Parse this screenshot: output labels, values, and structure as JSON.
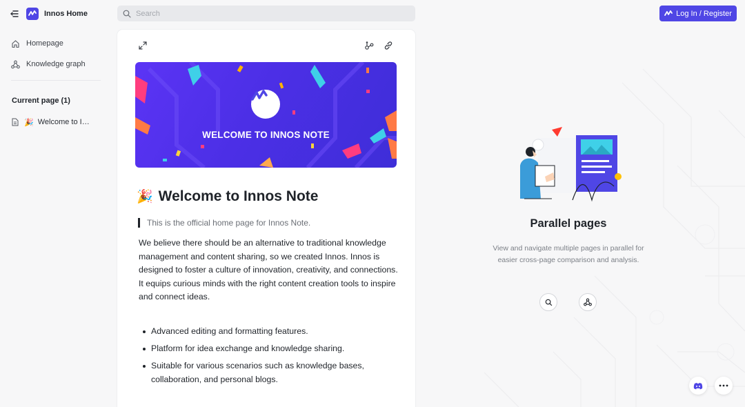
{
  "app": {
    "title": "Innos Home",
    "brand_color": "#4f46e5"
  },
  "search": {
    "placeholder": "Search",
    "value": ""
  },
  "auth": {
    "login_label": "Log In / Register"
  },
  "sidebar": {
    "items": [
      {
        "label": "Homepage",
        "icon": "home-icon"
      },
      {
        "label": "Knowledge graph",
        "icon": "graph-icon"
      }
    ],
    "current_section": {
      "title": "Current page (1)"
    },
    "pages": [
      {
        "emoji": "🎉",
        "label": "Welcome to Innos Note"
      }
    ]
  },
  "document": {
    "banner_text": "WELCOME TO INNOS NOTE",
    "title_emoji": "🎉",
    "title": "Welcome to Innos Note",
    "quote": "This is the official home page for Innos Note.",
    "paragraph": "We believe there should be an alternative to traditional knowledge management and content sharing, so we created Innos. Innos is designed to foster a culture of innovation, creativity, and connections. It equips curious minds with the right content creation tools to inspire and connect ideas.",
    "bullets": [
      "Advanced editing and formatting features.",
      "Platform for idea exchange and knowledge sharing.",
      "Suitable for various scenarios such as knowledge bases, collaboration, and personal blogs."
    ]
  },
  "parallel": {
    "title": "Parallel pages",
    "description": "View and navigate multiple pages in parallel for easier cross-page comparison and analysis."
  }
}
